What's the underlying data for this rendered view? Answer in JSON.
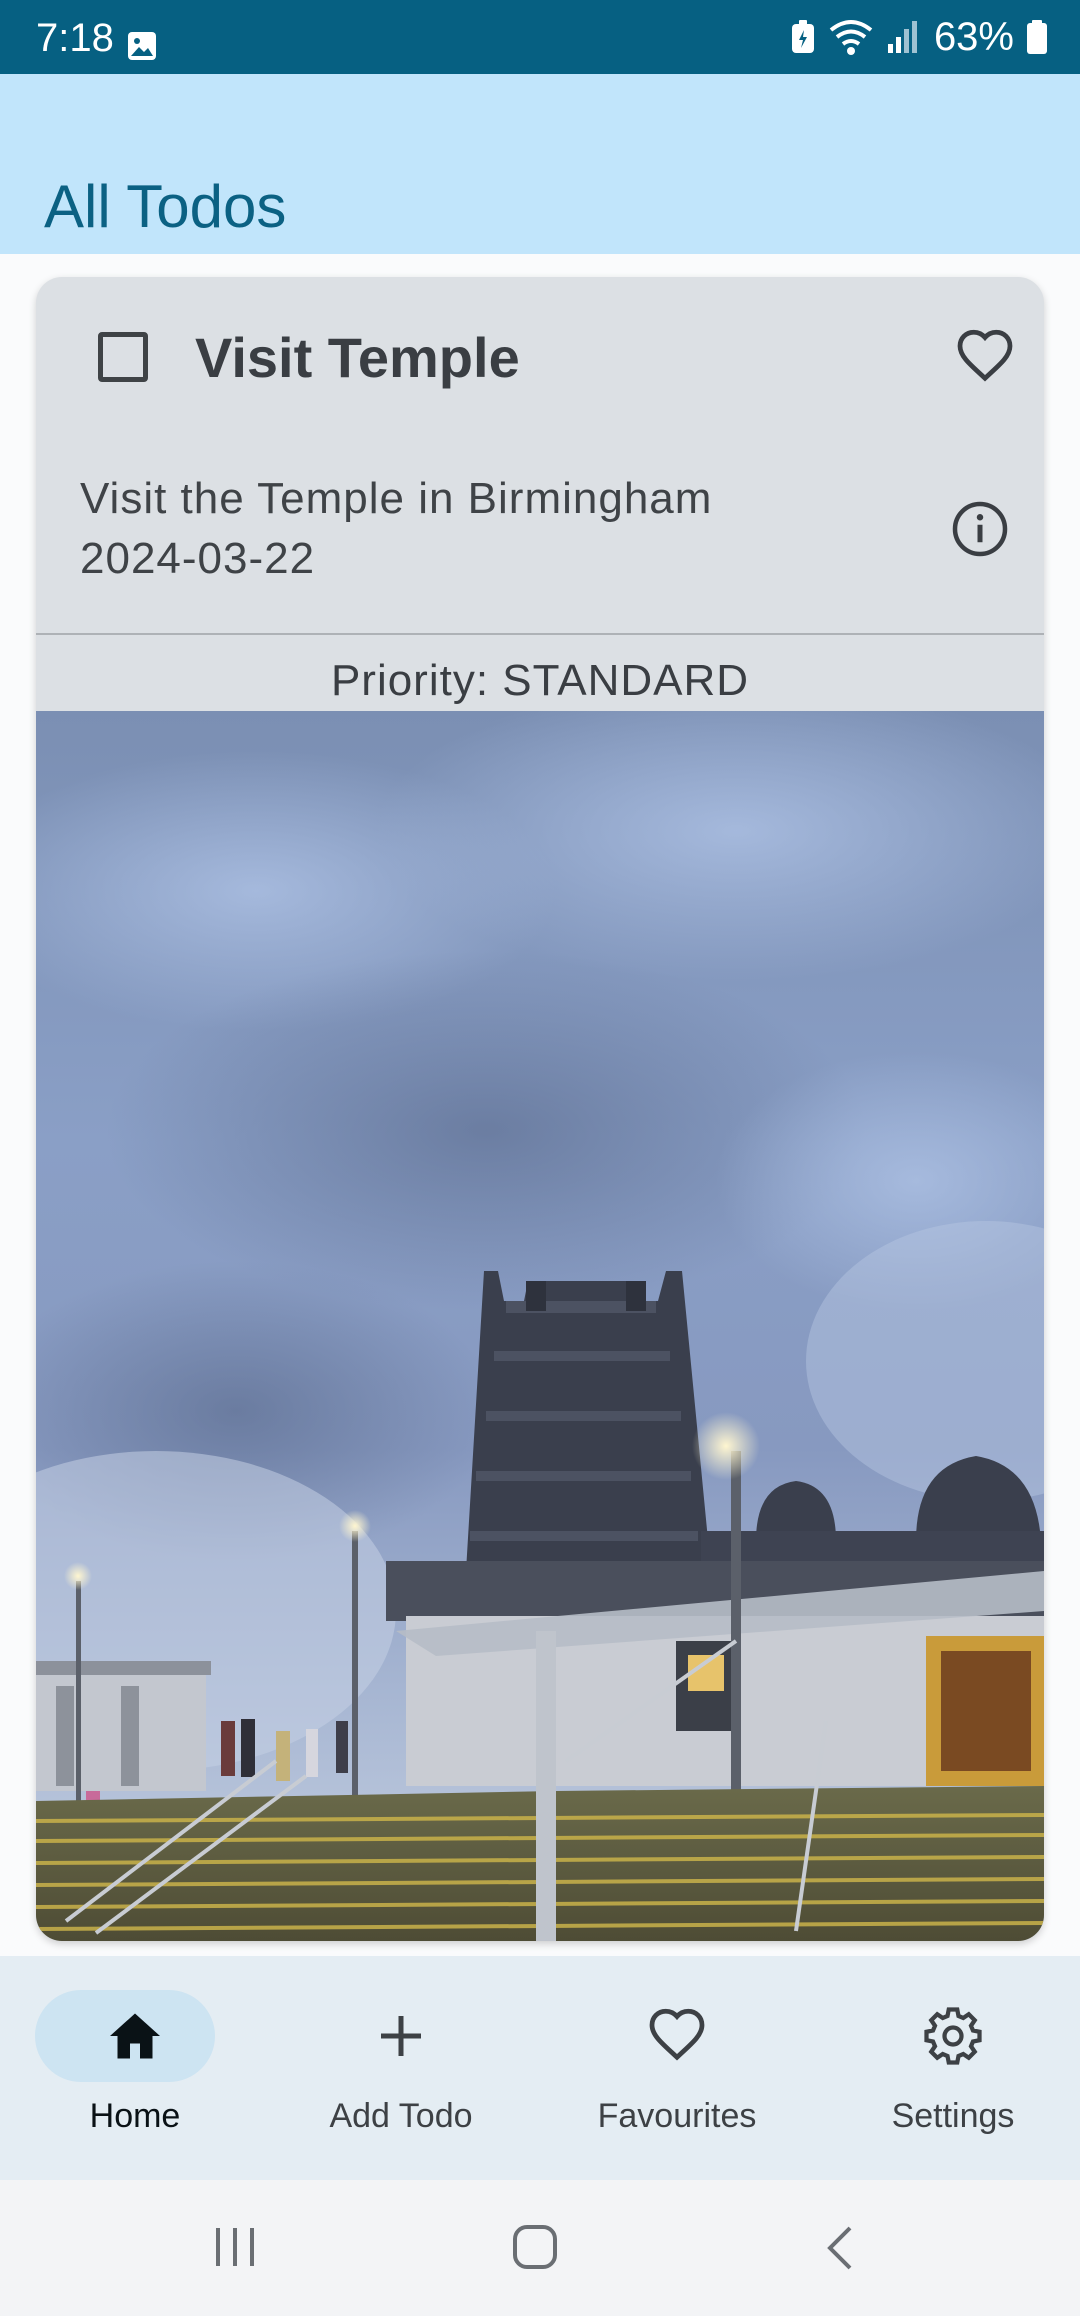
{
  "status_bar": {
    "time": "7:18",
    "battery": "63%",
    "icons": [
      "gallery-icon",
      "battery-saver-icon",
      "wifi-icon",
      "signal-icon",
      "battery-icon"
    ],
    "background": "#066082"
  },
  "app_bar": {
    "title": "All Todos",
    "background": "#c1e5fb",
    "title_color": "#0b6183"
  },
  "todo_card": {
    "title": "Visit Temple",
    "checked": false,
    "favourite": false,
    "description": "Visit the Temple in Birmingham",
    "date": "2024-03-22",
    "priority": "Priority: STANDARD",
    "image": "temple-photo-icon"
  },
  "bottom_nav": {
    "items": [
      {
        "label": "Home",
        "icon": "home-icon",
        "active": true
      },
      {
        "label": "Add Todo",
        "icon": "plus-icon",
        "active": false
      },
      {
        "label": "Favourites",
        "icon": "heart-icon",
        "active": false
      },
      {
        "label": "Settings",
        "icon": "gear-icon",
        "active": false
      }
    ]
  },
  "system_nav": {
    "icons": [
      "recents-icon",
      "home-circle-icon",
      "back-icon"
    ]
  }
}
